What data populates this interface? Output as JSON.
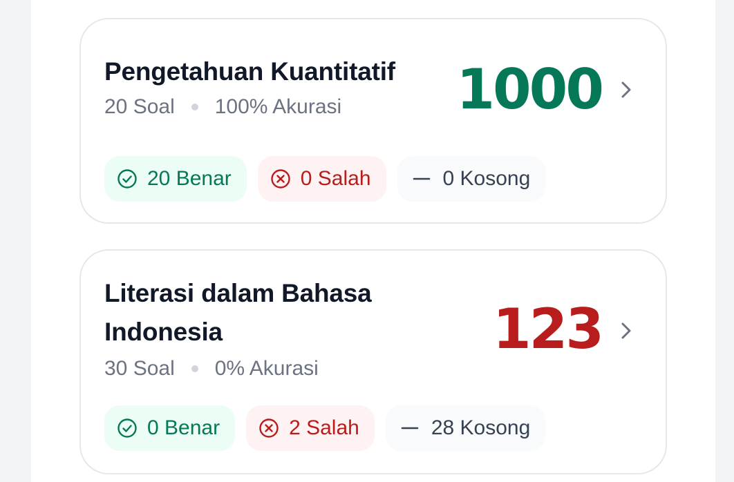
{
  "cards": [
    {
      "title": "Pengetahuan Kuantitatif",
      "questions": "20 Soal",
      "accuracy": "100% Akurasi",
      "score": "1000",
      "correct": "20 Benar",
      "wrong": "0 Salah",
      "empty": "0 Kosong",
      "score_color": "#047857"
    },
    {
      "title": "Literasi dalam Bahasa Indonesia",
      "questions": "30 Soal",
      "accuracy": "0% Akurasi",
      "score": "123",
      "correct": "0 Benar",
      "wrong": "2 Salah",
      "empty": "28 Kosong",
      "score_color": "#b91c1c"
    }
  ],
  "icons": {
    "correct": "check-circle-icon",
    "wrong": "x-circle-icon",
    "empty": "dash-icon",
    "open": "chevron-right-icon"
  },
  "colors": {
    "correct": "#047857",
    "wrong": "#b91c1c",
    "empty": "#374151"
  }
}
